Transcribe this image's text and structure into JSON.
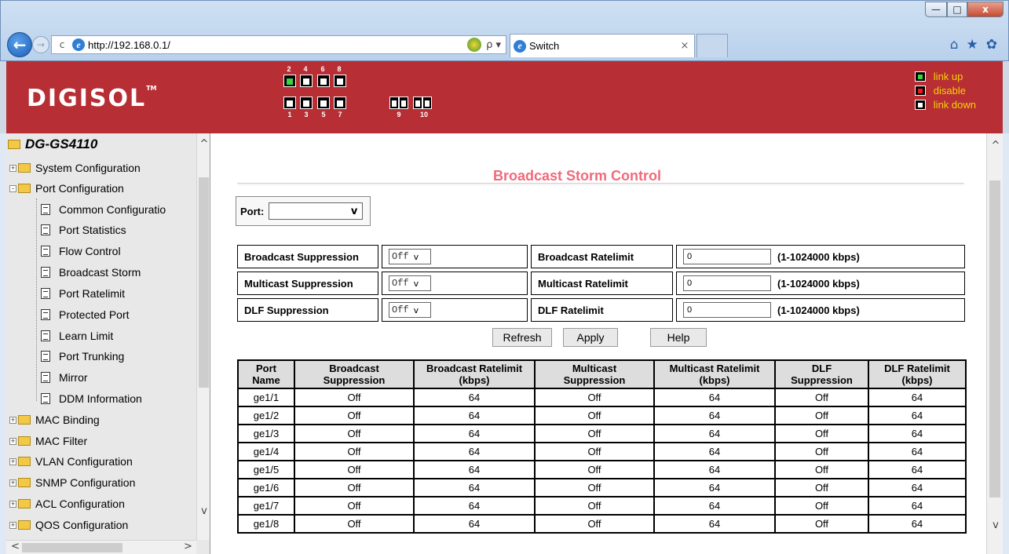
{
  "browser": {
    "url": "http://192.168.0.1/",
    "tab_title": "Switch",
    "tab_close": "×",
    "window_buttons": [
      "—",
      "□",
      "x"
    ],
    "back_arrow": "←",
    "forward_arrow": "→",
    "refresh_glyph": "c",
    "search_glyph": "ρ ▾",
    "tools_glyphs": [
      "⌂",
      "★",
      "✿"
    ]
  },
  "header": {
    "brand": "DIGISOL",
    "brand_tm": "TM",
    "port_top_numbers": [
      "2",
      "4",
      "6",
      "8"
    ],
    "port_bottom_numbers": [
      "1",
      "3",
      "5",
      "7",
      "9",
      "10"
    ],
    "port_status": {
      "2": "up"
    },
    "legend": [
      {
        "label": "link up",
        "color": "#3fd33f"
      },
      {
        "label": "disable",
        "color": "#f01818"
      },
      {
        "label": "link down",
        "color": "#ffffff"
      }
    ],
    "header_color": "#b72e34",
    "legend_text_color": "#f4d400"
  },
  "sidebar": {
    "root": "DG-GS4110",
    "groups_before": [
      {
        "label": "System Configuration",
        "expander": "+"
      }
    ],
    "open_group": {
      "label": "Port Configuration",
      "expander": "-"
    },
    "children": [
      "Common Configuratio",
      "Port Statistics",
      "Flow Control",
      "Broadcast Storm",
      "Port Ratelimit",
      "Protected Port",
      "Learn Limit",
      "Port Trunking",
      "Mirror",
      "DDM Information"
    ],
    "groups_after": [
      "MAC Binding",
      "MAC Filter",
      "VLAN Configuration",
      "SNMP Configuration",
      "ACL Configuration",
      "QOS Configuration"
    ],
    "scroll_up": "^",
    "scroll_down": "v",
    "scroll_left": "<",
    "scroll_right": ">"
  },
  "main": {
    "title": "Broadcast Storm Control",
    "title_color": "#f06a7a",
    "port_label": "Port:",
    "port_value": "",
    "port_chevron": "v",
    "suppression_rows": [
      {
        "label": "Broadcast Suppression",
        "value": "Off",
        "rate_label": "Broadcast Ratelimit",
        "rate_value": "0",
        "rate_hint": "(1-1024000 kbps)"
      },
      {
        "label": "Multicast Suppression",
        "value": "Off",
        "rate_label": "Multicast Ratelimit",
        "rate_value": "0",
        "rate_hint": "(1-1024000 kbps)"
      },
      {
        "label": "DLF Suppression",
        "value": "Off",
        "rate_label": "DLF Ratelimit",
        "rate_value": "0",
        "rate_hint": "(1-1024000 kbps)"
      }
    ],
    "select_chevron": "v",
    "buttons": {
      "refresh": "Refresh",
      "apply": "Apply",
      "help": "Help"
    },
    "table_headers": [
      [
        "Port",
        "Name"
      ],
      [
        "Broadcast",
        "Suppression"
      ],
      [
        "Broadcast Ratelimit",
        "(kbps)"
      ],
      [
        "Multicast",
        "Suppression"
      ],
      [
        "Multicast Ratelimit",
        "(kbps)"
      ],
      [
        "DLF",
        "Suppression"
      ],
      [
        "DLF Ratelimit",
        "(kbps)"
      ]
    ],
    "table_rows": [
      [
        "ge1/1",
        "Off",
        "64",
        "Off",
        "64",
        "Off",
        "64"
      ],
      [
        "ge1/2",
        "Off",
        "64",
        "Off",
        "64",
        "Off",
        "64"
      ],
      [
        "ge1/3",
        "Off",
        "64",
        "Off",
        "64",
        "Off",
        "64"
      ],
      [
        "ge1/4",
        "Off",
        "64",
        "Off",
        "64",
        "Off",
        "64"
      ],
      [
        "ge1/5",
        "Off",
        "64",
        "Off",
        "64",
        "Off",
        "64"
      ],
      [
        "ge1/6",
        "Off",
        "64",
        "Off",
        "64",
        "Off",
        "64"
      ],
      [
        "ge1/7",
        "Off",
        "64",
        "Off",
        "64",
        "Off",
        "64"
      ],
      [
        "ge1/8",
        "Off",
        "64",
        "Off",
        "64",
        "Off",
        "64"
      ]
    ]
  }
}
